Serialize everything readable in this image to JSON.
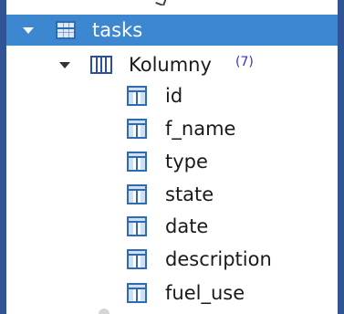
{
  "tree": {
    "table": {
      "label": "tasks",
      "icon": "table-icon",
      "expanded": true,
      "selected": true
    },
    "columns_folder": {
      "label": "Kolumny",
      "count": "(7)",
      "icon": "columns-folder-icon",
      "expanded": true
    },
    "columns": [
      {
        "label": "id",
        "icon": "column-icon"
      },
      {
        "label": "f_name",
        "icon": "column-icon"
      },
      {
        "label": "type",
        "icon": "column-icon"
      },
      {
        "label": "state",
        "icon": "column-icon"
      },
      {
        "label": "date",
        "icon": "column-icon"
      },
      {
        "label": "description",
        "icon": "column-icon"
      },
      {
        "label": "fuel_use",
        "icon": "column-icon"
      }
    ]
  },
  "colors": {
    "selection": "#3d86d0",
    "frame": "#2f5597",
    "count_text": "#3333cc"
  }
}
